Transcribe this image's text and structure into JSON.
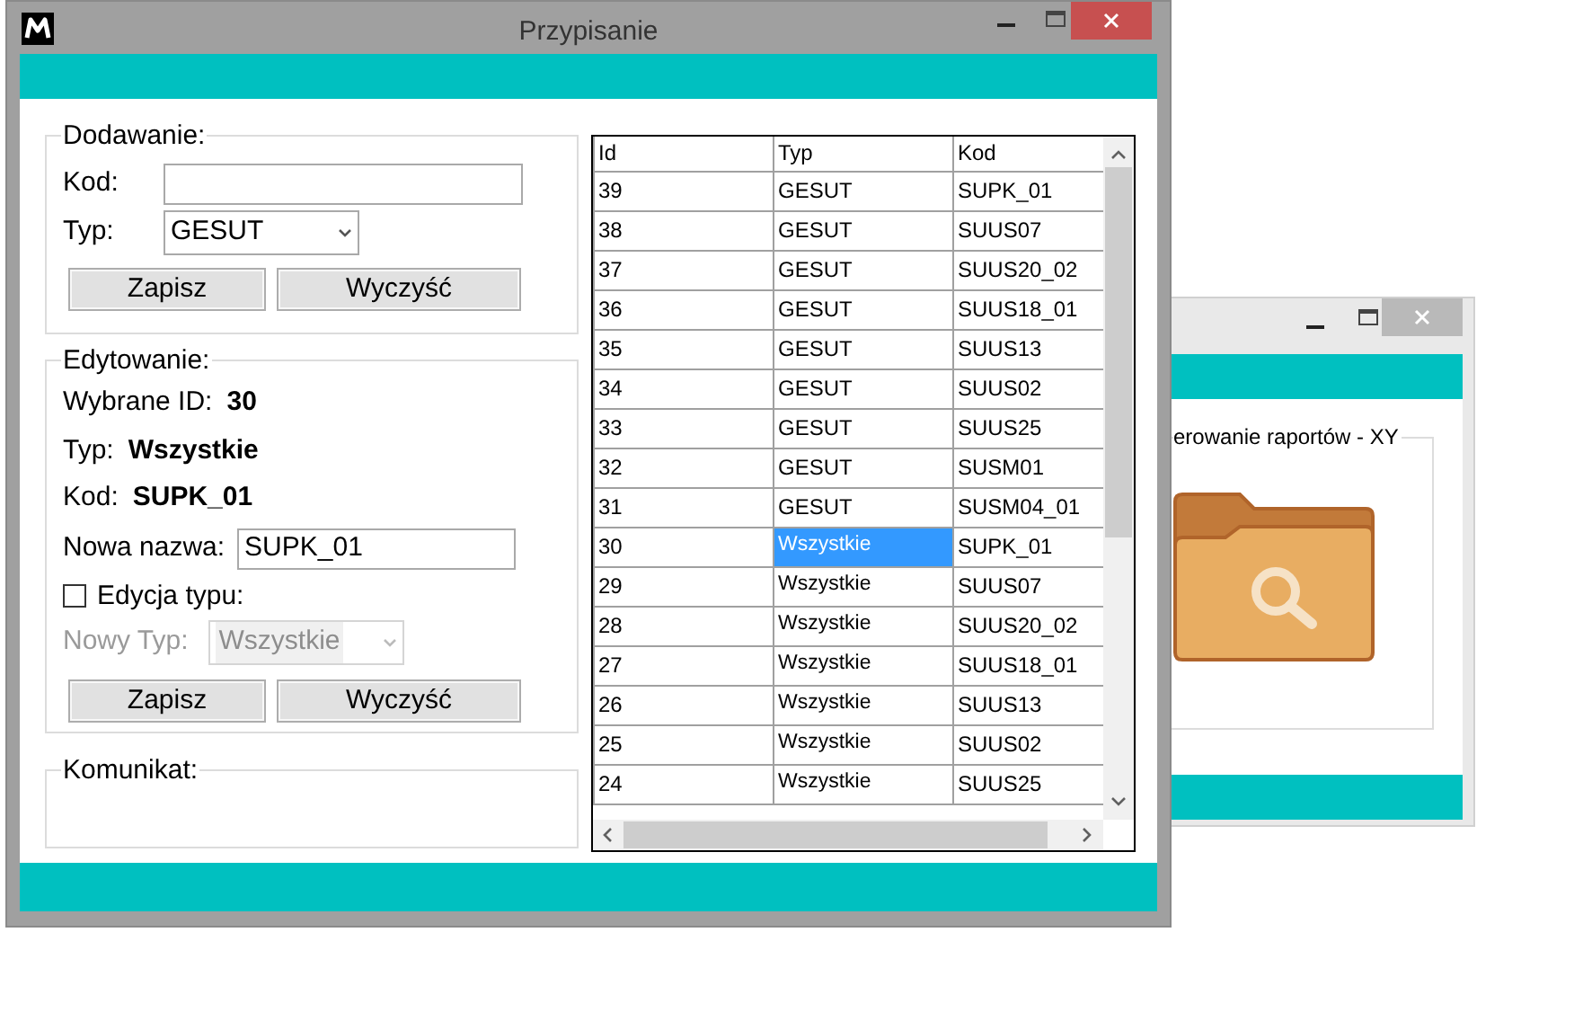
{
  "window": {
    "title": "Przypisanie"
  },
  "add_group": {
    "title": "Dodawanie:",
    "code": {
      "label": "Kod:"
    },
    "type": {
      "label": "Typ:",
      "value": "GESUT"
    },
    "buttons": [
      "Zapisz",
      "Wyczyść"
    ]
  },
  "edit_group": {
    "title": "Edytowanie:",
    "info": [
      {
        "label": "Wybrane ID:",
        "value": "30"
      },
      {
        "label": "Typ:",
        "value": "Wszystkie"
      },
      {
        "label": "Kod:",
        "value": "SUPK_01"
      }
    ],
    "new_name": {
      "label": "Nowa nazwa:",
      "value": "SUPK_01"
    },
    "type_edit": {
      "label": "Edycja typu:",
      "checked": false
    },
    "new_type": {
      "label": "Nowy Typ:",
      "value": "Wszystkie",
      "disabled": true
    },
    "buttons": [
      "Zapisz",
      "Wyczyść"
    ]
  },
  "message_group": {
    "title": "Komunikat:"
  },
  "table": {
    "columns": [
      "Id",
      "Typ",
      "Kod"
    ],
    "rows": [
      {
        "cells": [
          "39",
          "GESUT",
          "SUPK_01"
        ],
        "selected": false
      },
      {
        "cells": [
          "38",
          "GESUT",
          "SUUS07"
        ],
        "selected": false
      },
      {
        "cells": [
          "37",
          "GESUT",
          "SUUS20_02"
        ],
        "selected": false
      },
      {
        "cells": [
          "36",
          "GESUT",
          "SUUS18_01"
        ],
        "selected": false
      },
      {
        "cells": [
          "35",
          "GESUT",
          "SUUS13"
        ],
        "selected": false
      },
      {
        "cells": [
          "34",
          "GESUT",
          "SUUS02"
        ],
        "selected": false
      },
      {
        "cells": [
          "33",
          "GESUT",
          "SUUS25"
        ],
        "selected": false
      },
      {
        "cells": [
          "32",
          "GESUT",
          "SUSM01"
        ],
        "selected": false
      },
      {
        "cells": [
          "31",
          "GESUT",
          "SUSM04_01"
        ],
        "selected": false
      },
      {
        "cells": [
          "30",
          "Wszystkie",
          "SUPK_01"
        ],
        "selected": true
      },
      {
        "cells": [
          "29",
          "Wszystkie",
          "SUUS07"
        ],
        "selected": false
      },
      {
        "cells": [
          "28",
          "Wszystkie",
          "SUUS20_02"
        ],
        "selected": false
      },
      {
        "cells": [
          "27",
          "Wszystkie",
          "SUUS18_01"
        ],
        "selected": false
      },
      {
        "cells": [
          "26",
          "Wszystkie",
          "SUUS13"
        ],
        "selected": false
      },
      {
        "cells": [
          "25",
          "Wszystkie",
          "SUUS02"
        ],
        "selected": false
      },
      {
        "cells": [
          "24",
          "Wszystkie",
          "SUUS25"
        ],
        "selected": false
      }
    ]
  },
  "background_window": {
    "group_title": "erowanie raportów - XY"
  }
}
